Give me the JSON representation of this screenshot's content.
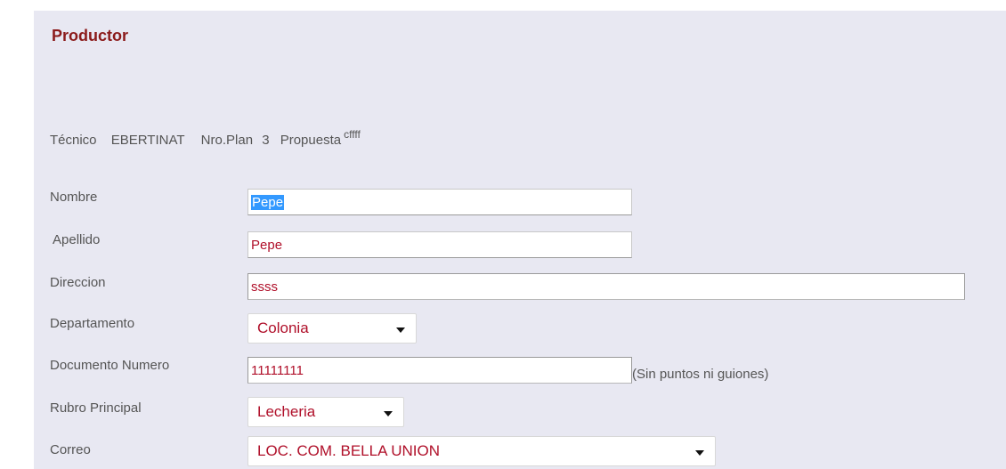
{
  "section": {
    "title": "Productor"
  },
  "info": {
    "tecnico_label": "Técnico",
    "tecnico_value": "EBERTINAT",
    "plan_label": "Nro.Plan",
    "plan_value": "3",
    "propuesta_label": "Propuesta",
    "propuesta_value": "cffff"
  },
  "form": {
    "nombre": {
      "label": "Nombre",
      "value": "Pepe"
    },
    "apellido": {
      "label": "Apellido",
      "value": "Pepe"
    },
    "direccion": {
      "label": "Direccion",
      "value": "ssss"
    },
    "departamento": {
      "label": "Departamento",
      "value": "Colonia"
    },
    "documento": {
      "label": "Documento Numero",
      "value": "11111111",
      "hint": "(Sin puntos ni guiones)"
    },
    "rubro": {
      "label": "Rubro Principal",
      "value": "Lecheria"
    },
    "correo": {
      "label": "Correo",
      "value": "LOC. COM. BELLA UNION"
    }
  }
}
